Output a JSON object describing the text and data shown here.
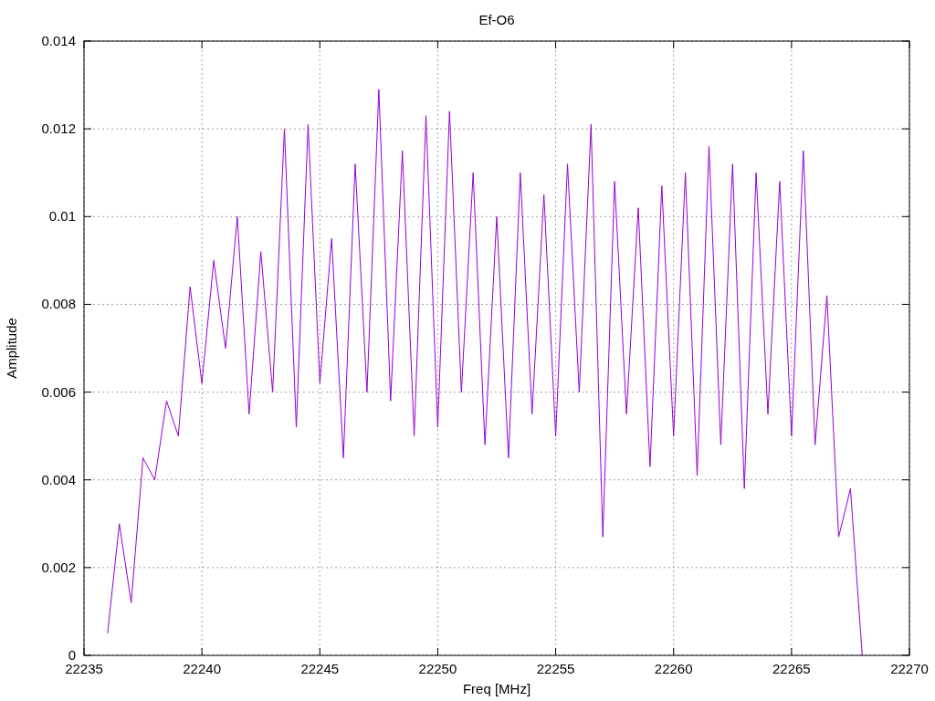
{
  "chart_data": {
    "type": "line",
    "title": "Ef-O6",
    "xlabel": "Freq [MHz]",
    "ylabel": "Amplitude",
    "x": [
      22236,
      22236.5,
      22237,
      22237.5,
      22238,
      22238.5,
      22239,
      22239.5,
      22240,
      22240.5,
      22241,
      22241.5,
      22242,
      22242.5,
      22243,
      22243.5,
      22244,
      22244.5,
      22245,
      22245.5,
      22246,
      22246.5,
      22247,
      22247.5,
      22248,
      22248.5,
      22249,
      22249.5,
      22250,
      22250.5,
      22251,
      22251.5,
      22252,
      22252.5,
      22253,
      22253.5,
      22254,
      22254.5,
      22255,
      22255.5,
      22256,
      22256.5,
      22257,
      22257.5,
      22258,
      22258.5,
      22259,
      22259.5,
      22260,
      22260.5,
      22261,
      22261.5,
      22262,
      22262.5,
      22263,
      22263.5,
      22264,
      22264.5,
      22265,
      22265.5,
      22266,
      22266.5,
      22267,
      22267.5,
      22268
    ],
    "series": [
      {
        "color": "#9400d3",
        "values": [
          0.0005,
          0.003,
          0.0012,
          0.0045,
          0.004,
          0.0058,
          0.005,
          0.0084,
          0.0062,
          0.009,
          0.007,
          0.01,
          0.0055,
          0.0092,
          0.006,
          0.012,
          0.0052,
          0.0121,
          0.0062,
          0.0095,
          0.0045,
          0.0112,
          0.006,
          0.0129,
          0.0058,
          0.0115,
          0.005,
          0.0123,
          0.0052,
          0.0124,
          0.006,
          0.011,
          0.0048,
          0.01,
          0.0045,
          0.011,
          0.0055,
          0.0105,
          0.005,
          0.0112,
          0.006,
          0.0121,
          0.0027,
          0.0108,
          0.0055,
          0.0102,
          0.0043,
          0.0107,
          0.005,
          0.011,
          0.0041,
          0.0116,
          0.0048,
          0.0112,
          0.0038,
          0.011,
          0.0055,
          0.0108,
          0.005,
          0.0115,
          0.0048,
          0.0082,
          0.0027,
          0.0038,
          0.0
        ]
      }
    ],
    "grid": true,
    "xlim": [
      22235,
      22270
    ],
    "ylim": [
      0,
      0.014
    ],
    "xticks": [
      22235,
      22240,
      22245,
      22250,
      22255,
      22260,
      22265,
      22270
    ],
    "yticks": [
      0,
      0.002,
      0.004,
      0.006,
      0.008,
      0.01,
      0.012,
      0.014
    ]
  }
}
